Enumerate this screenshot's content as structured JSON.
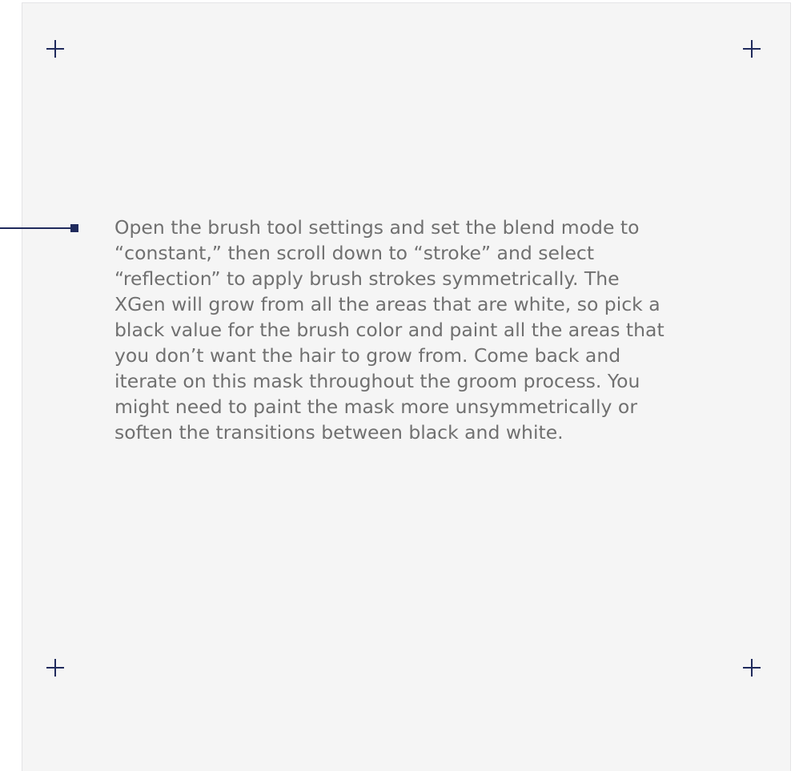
{
  "colors": {
    "accent": "#1f2a5c",
    "panel_background": "#f5f5f5",
    "text": "#707070"
  },
  "content": {
    "paragraph": "Open the brush tool settings and set the blend mode to “constant,” then scroll down to “stroke” and select “reflection” to apply brush strokes symmetrically. The XGen will grow from all the areas that are white, so pick a black value for the brush color and paint all the areas that you don’t want the hair to grow from. Come back and iterate on this mask throughout the groom process. You might need to paint the mask more unsymmetrically or soften the transitions between black and white."
  },
  "icons": {
    "corner_marker": "plus-crosshair-icon",
    "pointer": "callout-pointer-icon"
  }
}
